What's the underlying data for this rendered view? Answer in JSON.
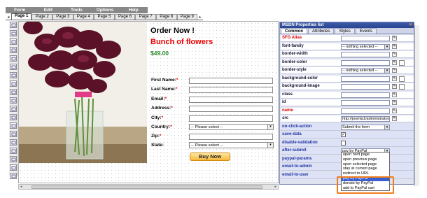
{
  "menubar": [
    "Form",
    "Edit",
    "Tools",
    "Options",
    "Help"
  ],
  "page_tabs": [
    "Page 1",
    "Page 2",
    "Page 3",
    "Page 4",
    "Page 5",
    "Page 6",
    "Page 7",
    "Page 8",
    "Page 9"
  ],
  "tools": [
    "pointer-tool-icon",
    "text-tool-icon",
    "image-tool-icon",
    "input-tool-icon",
    "textarea-tool-icon",
    "select-tool-icon",
    "checkbox-tool-icon",
    "radio-tool-icon",
    "button-tool-icon",
    "align-left-icon",
    "align-center-icon",
    "align-right-icon",
    "grid-icon",
    "table-tool-icon",
    "file-tool-icon",
    "captcha-tool-icon",
    "hidden-tool-icon",
    "user-tool-icon",
    "link-tool-icon"
  ],
  "form": {
    "title": "Order Now !",
    "subtitle": "Bunch of flowers",
    "price": "$49.00",
    "fields": [
      {
        "label": "First Name:",
        "required": "*"
      },
      {
        "label": "Last Name:",
        "required": "*"
      },
      {
        "label": "Email:",
        "required": "*"
      },
      {
        "label": "Address:",
        "required": "*"
      },
      {
        "label": "City:",
        "required": "*"
      },
      {
        "label": "Country:",
        "required": "*",
        "select": "-- Please select --"
      },
      {
        "label": "Zip:",
        "required": "*"
      },
      {
        "label": "State:",
        "required": "",
        "select": "-- Please select --"
      }
    ],
    "buy_button": "Buy Now"
  },
  "props": {
    "title": "MSDN Properties list",
    "tabs": [
      "Common",
      "Attributes",
      "Styles",
      "Events"
    ],
    "rows": [
      {
        "key": "SFG Alias",
        "style": "red",
        "value": ""
      },
      {
        "key": "font-family",
        "style": "bk",
        "value": "-- nothing selected --",
        "dd": true
      },
      {
        "key": "border-width",
        "style": "bk",
        "value": ""
      },
      {
        "key": "border-color",
        "style": "bk",
        "value": ""
      },
      {
        "key": "border-style",
        "style": "bk",
        "value": "-- nothing selected --",
        "dd": true
      },
      {
        "key": "background-color",
        "style": "bk",
        "value": ""
      },
      {
        "key": "background-image",
        "style": "bk",
        "value": ""
      },
      {
        "key": "class",
        "style": "bk",
        "value": ""
      },
      {
        "key": "id",
        "style": "bk",
        "value": ""
      },
      {
        "key": "name",
        "style": "red",
        "value": ""
      },
      {
        "key": "src",
        "style": "bk",
        "value": "http://joomla1/administrator/"
      },
      {
        "key": "on-click-action",
        "style": "blueK",
        "value": "Submit the form",
        "dd": true
      },
      {
        "key": "save-data",
        "style": "blueK",
        "check": "✓"
      },
      {
        "key": "disable-validation",
        "style": "blueK",
        "check": ""
      },
      {
        "key": "after-submit",
        "style": "blueK",
        "value": "pay by PayPal",
        "dd": true
      },
      {
        "key": "paypal-params",
        "style": "blueK",
        "value": ""
      },
      {
        "key": "email-to-admin",
        "style": "blueK",
        "value": ""
      },
      {
        "key": "email-to-user",
        "style": "blueK",
        "value": ""
      }
    ],
    "dropdown_options": [
      "open next page",
      "open previous page",
      "open selected page",
      "stay at current page",
      "redirect to URL",
      "pay by PayPal",
      "donate by PayPal",
      "add to PayPal cart"
    ],
    "dropdown_selected": "pay by PayPal"
  },
  "colors": {
    "accent": "#f07d1c",
    "panel_title": "#2a4590",
    "required": "#dd0000",
    "price": "#2a8a2a"
  }
}
